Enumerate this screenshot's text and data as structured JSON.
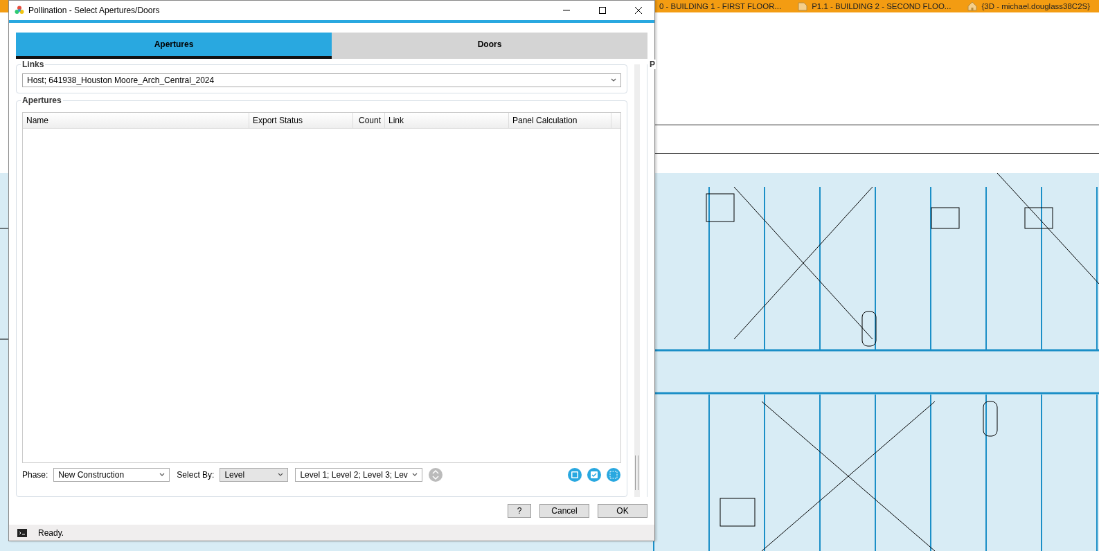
{
  "background_tabs": [
    {
      "label": "0 - BUILDING 1 - FIRST FLOOR...",
      "kind": "plain"
    },
    {
      "label": "P1.1 - BUILDING 2 - SECOND FLOO...",
      "kind": "sheet"
    },
    {
      "label": "{3D - michael.douglass38C2S}",
      "kind": "home"
    }
  ],
  "window": {
    "title": "Pollination - Select Apertures/Doors"
  },
  "tabs": [
    {
      "label": "Apertures",
      "selected": true
    },
    {
      "label": "Doors",
      "selected": false
    }
  ],
  "links": {
    "title": "Links",
    "value": "Host; 641938_Houston Moore_Arch_Central_2024"
  },
  "apertures": {
    "title": "Apertures",
    "columns": [
      "Name",
      "Export Status",
      "Count",
      "Link",
      "Panel Calculation"
    ]
  },
  "filters": {
    "phase_label": "Phase:",
    "phase": "New Construction",
    "select_by_label": "Select By:",
    "select_by": "Level",
    "levels": "Level 1; Level 2; Level 3; Lev"
  },
  "side_panel": {
    "title": "P"
  },
  "buttons": [
    "?",
    "Cancel",
    "OK"
  ],
  "status_bar": {
    "text": "Ready."
  }
}
